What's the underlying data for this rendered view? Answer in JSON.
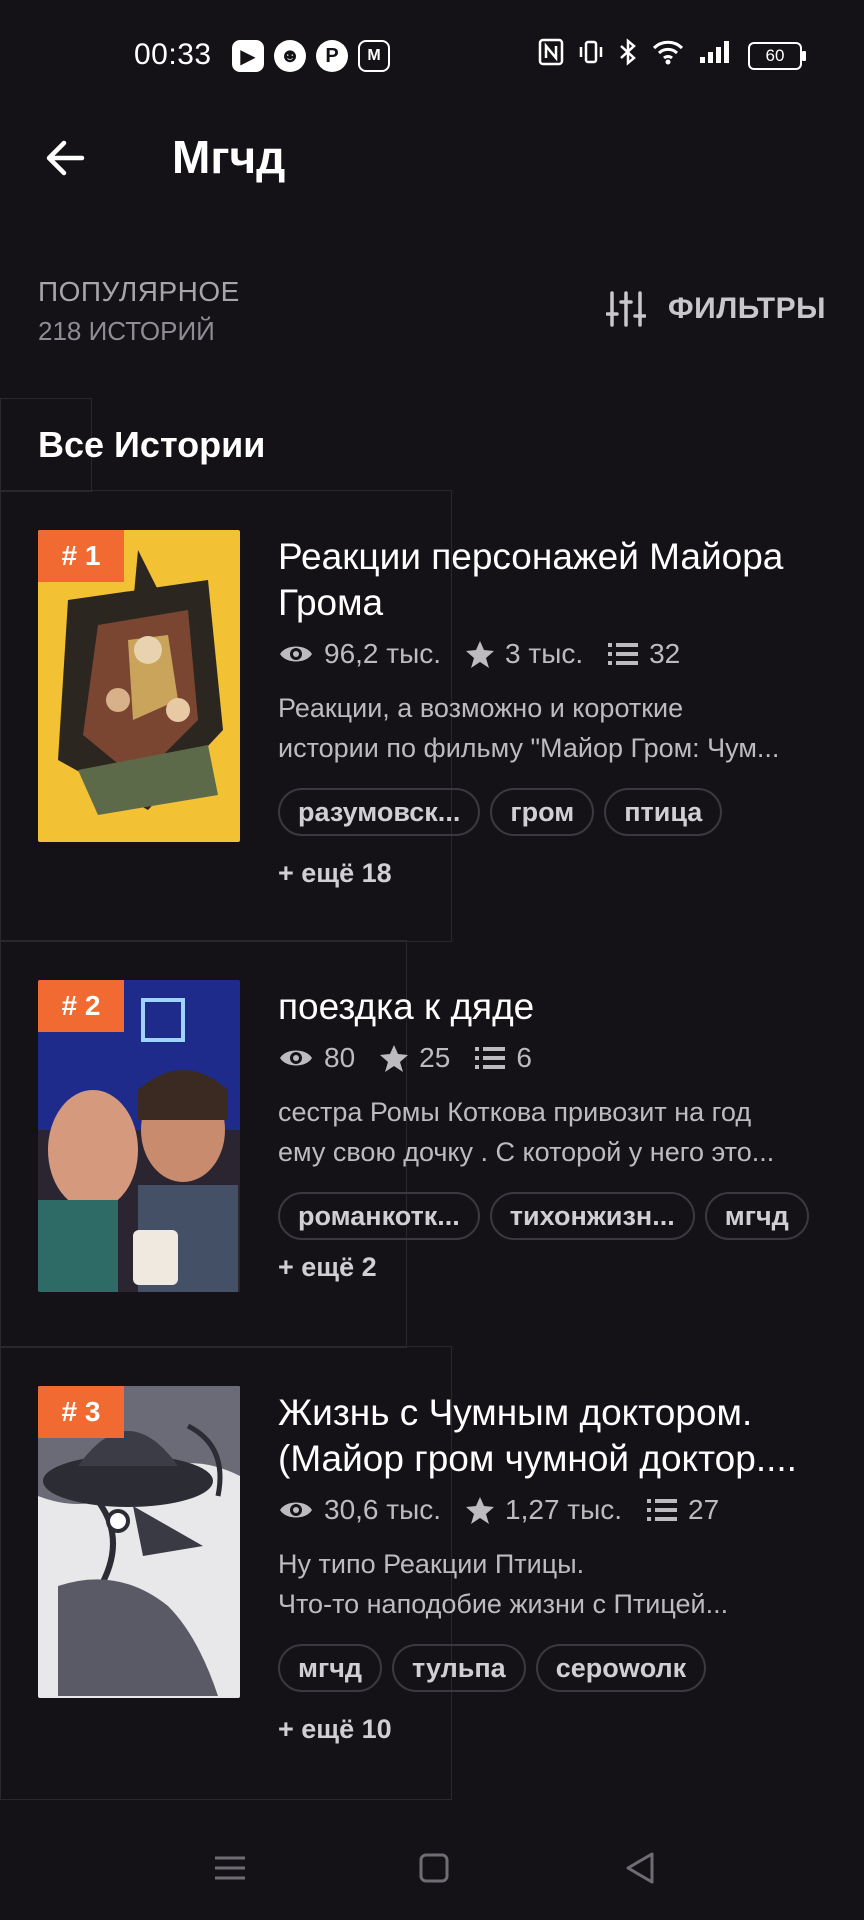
{
  "status": {
    "time": "00:33",
    "apps": [
      "▶",
      "☻",
      "P",
      "M"
    ],
    "battery": "60"
  },
  "header": {
    "title": "Мгчд"
  },
  "section": {
    "label": "ПОПУЛЯРНОЕ",
    "count": "218 ИСТОРИЙ",
    "filters_label": "ФИЛЬТРЫ",
    "list_title": "Все Истории"
  },
  "colors": {
    "background": "#141216",
    "accent": "#f06a32",
    "tag_border": "#3b393f"
  },
  "stories": [
    {
      "rank": "# 1",
      "title_lines": [
        "Реакции персонажей Майора",
        "Грома"
      ],
      "views": "96,2 тыс.",
      "stars": "3 тыс.",
      "parts": "32",
      "desc_lines": [
        "Реакции, а возможно и короткие",
        "истории по фильму \"Майор Гром: Чум..."
      ],
      "tags": [
        "разумовск...",
        "гром",
        "птица"
      ],
      "more": "+ ещё 18"
    },
    {
      "rank": "# 2",
      "title_lines": [
        "поездка к дяде"
      ],
      "views": "80",
      "stars": "25",
      "parts": "6",
      "desc_lines": [
        "сестра Ромы Коткова привозит на год",
        "ему свою дочку .  С которой у него это..."
      ],
      "tags": [
        "романкотк...",
        "тихонжизн...",
        "мгчд"
      ],
      "more": "+ ещё 2"
    },
    {
      "rank": "# 3",
      "title_lines": [
        "Жизнь с Чумным доктором.",
        "(Майор гром чумной доктор...."
      ],
      "views": "30,6 тыс.",
      "stars": "1,27 тыс.",
      "parts": "27",
      "desc_lines": [
        "Ну типо Реакции Птицы.",
        "Что-то наподобие жизни с Птицей..."
      ],
      "tags": [
        "мгчд",
        "тульпа",
        "серowолк"
      ],
      "more": "+ ещё 10"
    }
  ],
  "icons": [
    "back-arrow-icon",
    "filter-sliders-icon",
    "eye-icon",
    "star-icon",
    "list-icon",
    "menu-icon",
    "home-square-icon",
    "back-triangle-icon"
  ]
}
